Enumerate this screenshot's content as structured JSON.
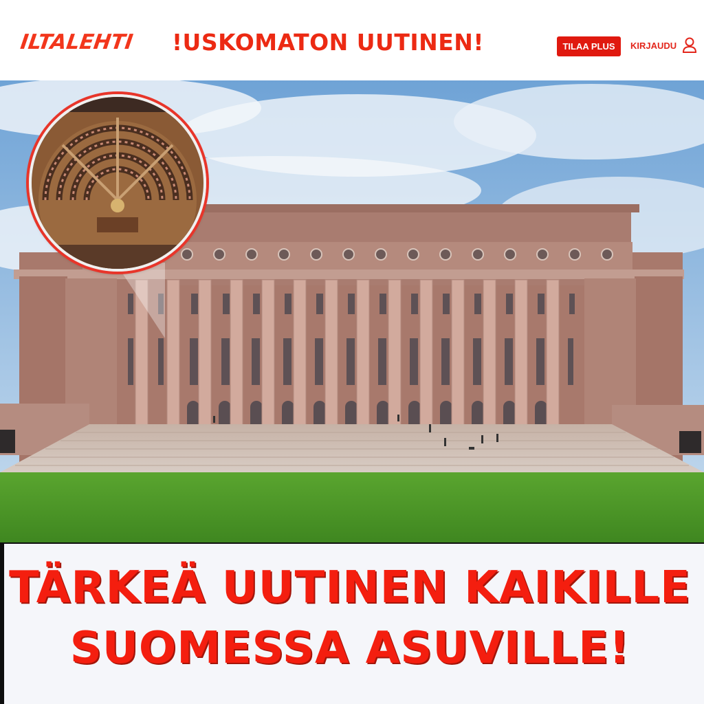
{
  "header": {
    "logo": "ILTALEHTI",
    "headline": "!USKOMATON UUTINEN!",
    "subscribe_label": "TILAA PLUS",
    "login_label": "KIRJAUDU",
    "login_icon": "user-icon"
  },
  "hero": {
    "inset_icon": "parliament-chamber-photo"
  },
  "caption": {
    "line1": "TÄRKEÄ UUTINEN KAIKILLE",
    "line2": "SUOMESSA ASUVILLE!"
  },
  "colors": {
    "brand_red": "#e0190f",
    "caption_red": "#f41e0f",
    "sky": "#9cc3e6",
    "grass": "#4e9a2a",
    "building": "#b78a7c"
  }
}
